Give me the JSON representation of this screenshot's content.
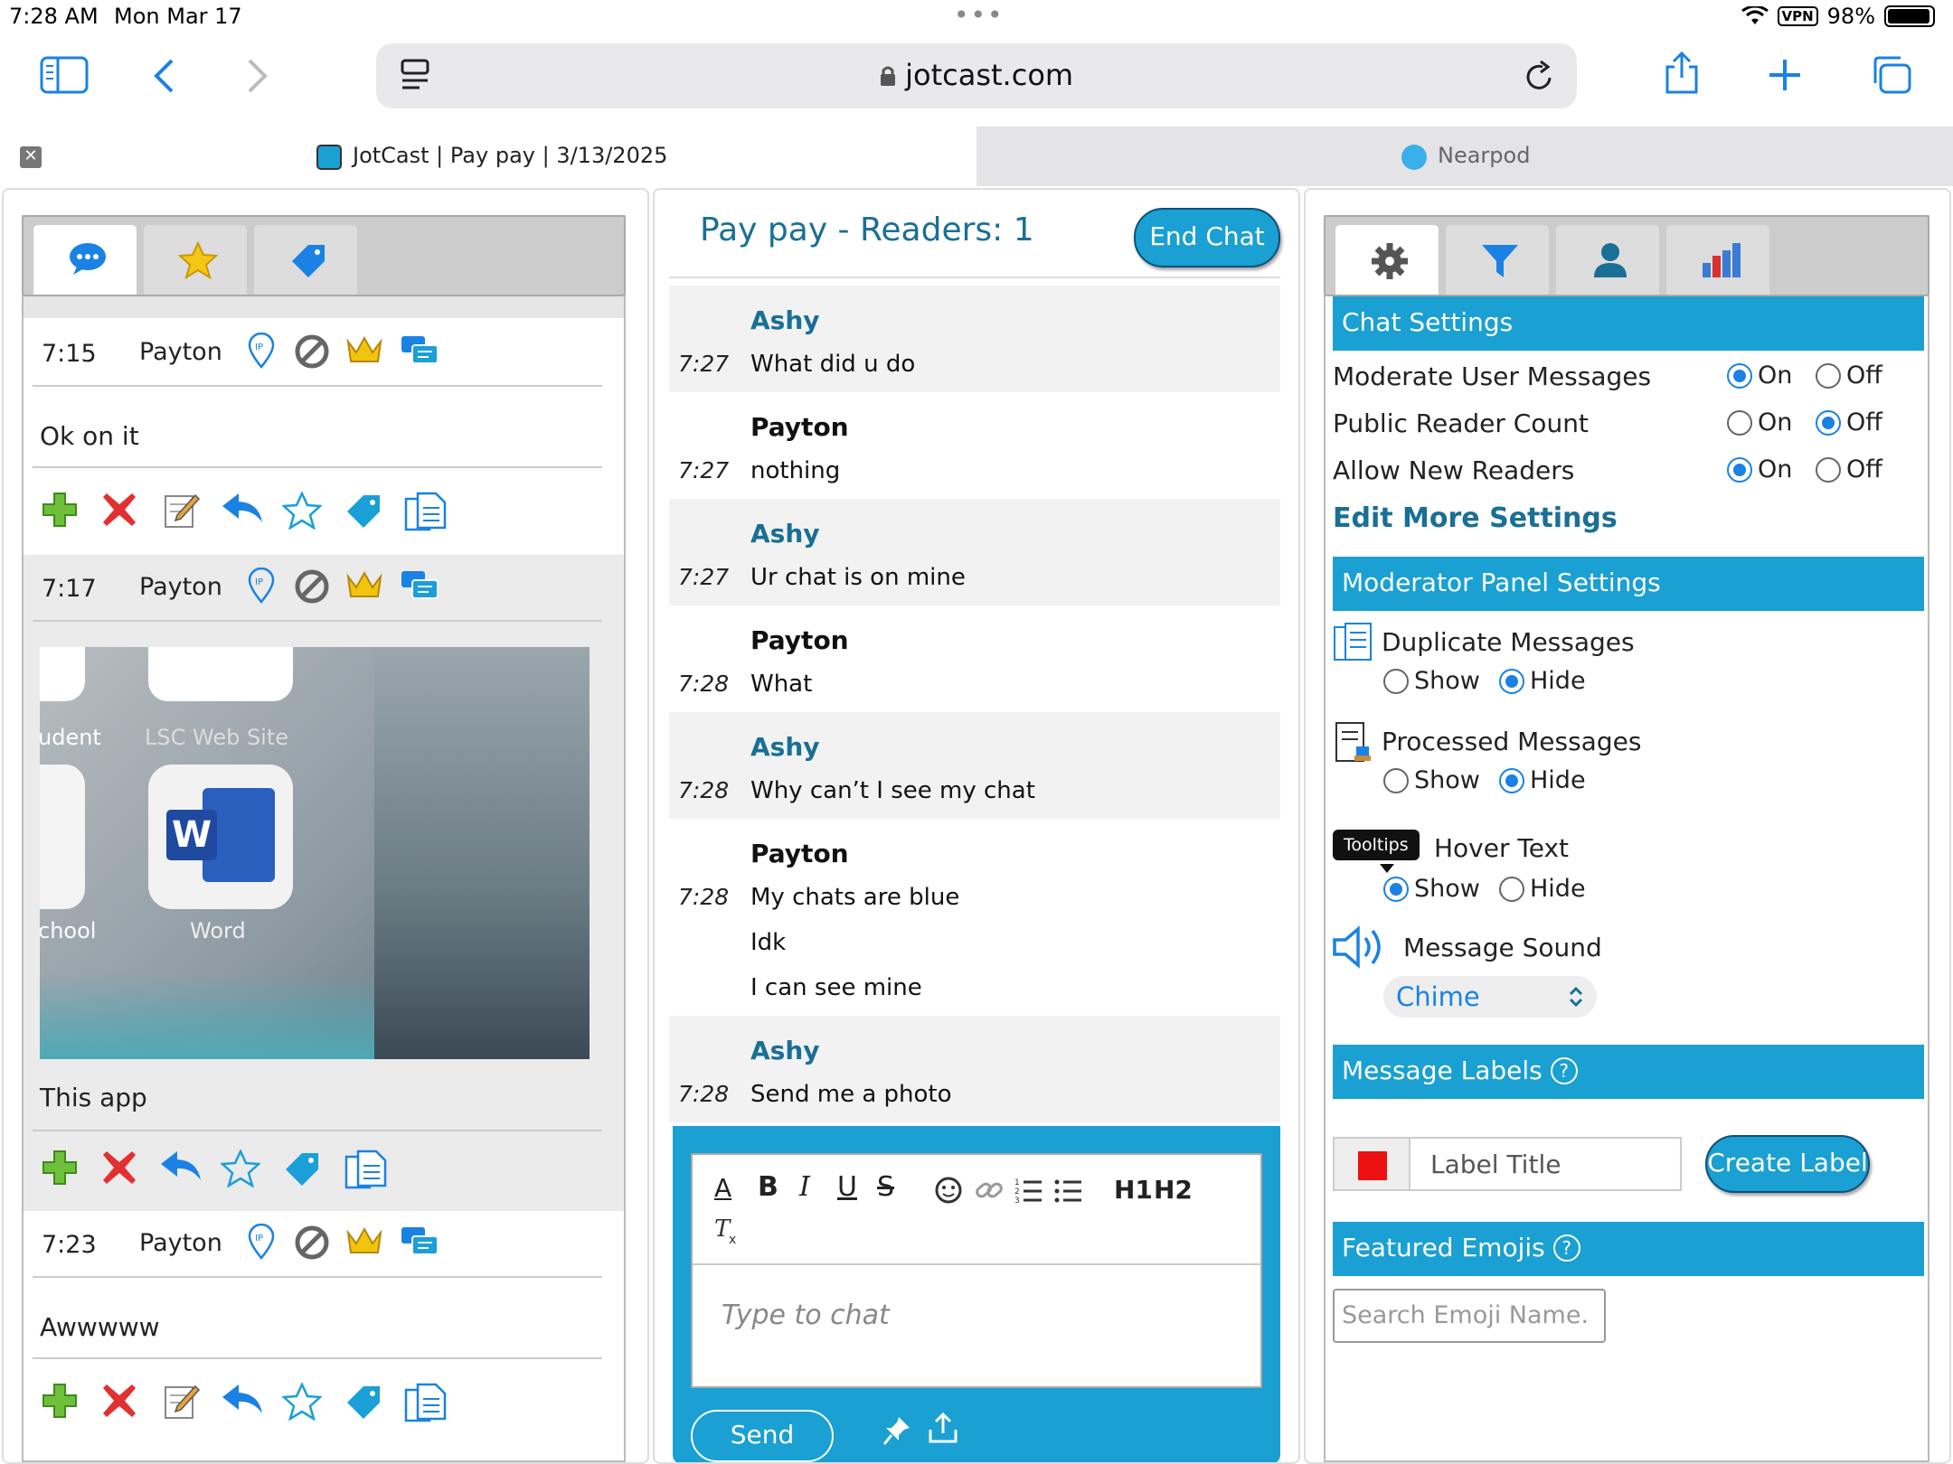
{
  "status_bar": {
    "time": "7:28 AM",
    "date": "Mon Mar 17",
    "vpn": "VPN",
    "battery": "98%"
  },
  "browser": {
    "url": "jotcast.com"
  },
  "tabs": [
    {
      "title": "JotCast | Pay pay | 3/13/2025"
    },
    {
      "title": "Nearpod"
    }
  ],
  "left_panel": {
    "messages": [
      {
        "time": "7:15",
        "name": "Payton",
        "text": "Ok on it"
      },
      {
        "time": "7:17",
        "name": "Payton",
        "text": "This app",
        "image_labels": [
          "udent",
          "LSC Web Site",
          "chool",
          "Word"
        ]
      },
      {
        "time": "7:23",
        "name": "Payton",
        "text": "Awwwww"
      }
    ]
  },
  "middle_panel": {
    "title": "Pay pay - Readers: 1",
    "end_chat": "End Chat",
    "chat": [
      {
        "name": "Ashy",
        "time": "7:27",
        "lines": [
          "What did u do"
        ]
      },
      {
        "name": "Payton",
        "time": "7:27",
        "lines": [
          "nothing"
        ]
      },
      {
        "name": "Ashy",
        "time": "7:27",
        "lines": [
          "Ur chat is on mine"
        ]
      },
      {
        "name": "Payton",
        "time": "7:28",
        "lines": [
          "What"
        ]
      },
      {
        "name": "Ashy",
        "time": "7:28",
        "lines": [
          "Why can’t I see my chat"
        ]
      },
      {
        "name": "Payton",
        "time": "7:28",
        "lines": [
          "My chats are blue",
          "Idk",
          "I can see mine"
        ]
      },
      {
        "name": "Ashy",
        "time": "7:28",
        "lines": [
          "Send me a photo"
        ]
      }
    ],
    "editor_toolbar": [
      "A",
      "B",
      "I",
      "U",
      "S",
      "H1",
      "H2"
    ],
    "input_placeholder": "Type to chat",
    "send": "Send"
  },
  "right_panel": {
    "chat_settings_header": "Chat Settings",
    "settings": [
      {
        "label": "Moderate User Messages",
        "value": "On"
      },
      {
        "label": "Public Reader Count",
        "value": "Off"
      },
      {
        "label": "Allow New Readers",
        "value": "On"
      }
    ],
    "on_label": "On",
    "off_label": "Off",
    "edit_more": "Edit More Settings",
    "moderator_header": "Moderator Panel Settings",
    "mod_settings": [
      {
        "label": "Duplicate Messages",
        "value": "Hide"
      },
      {
        "label": "Processed Messages",
        "value": "Hide"
      },
      {
        "label": "Hover Text",
        "value": "Show"
      }
    ],
    "show_label": "Show",
    "hide_label": "Hide",
    "tooltip": "Tooltips",
    "sound_label": "Message Sound",
    "sound_value": "Chime",
    "labels_header": "Message Labels",
    "label_color": "#ee1111",
    "label_placeholder": "Label Title",
    "create_label": "Create Label",
    "emojis_header": "Featured Emojis",
    "emoji_placeholder": "Search Emoji Name."
  }
}
